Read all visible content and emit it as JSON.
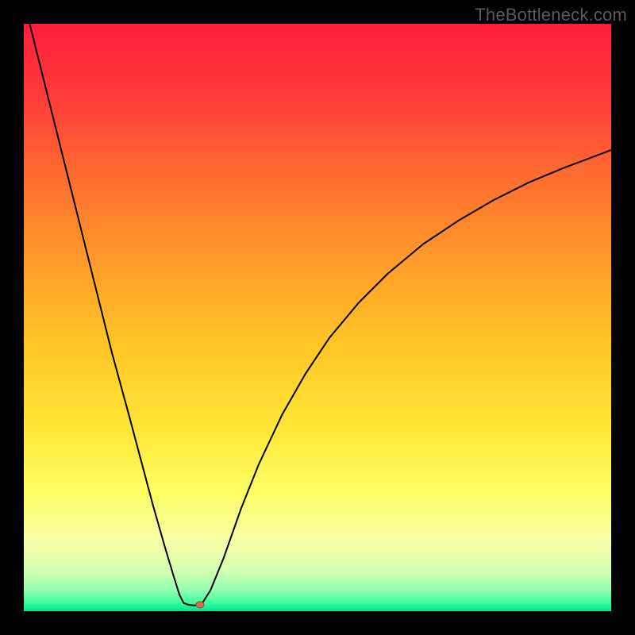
{
  "watermark": "TheBottleneck.com",
  "chart_data": {
    "type": "line",
    "title": "",
    "xlabel": "",
    "ylabel": "",
    "xlim": [
      0,
      100
    ],
    "ylim": [
      0,
      100
    ],
    "grid": false,
    "legend": false,
    "background_gradient": {
      "direction": "vertical",
      "stops": [
        {
          "offset": 0.0,
          "color": "#ff1e3c"
        },
        {
          "offset": 0.12,
          "color": "#ff3a3a"
        },
        {
          "offset": 0.25,
          "color": "#ff6a30"
        },
        {
          "offset": 0.4,
          "color": "#ff9a2a"
        },
        {
          "offset": 0.55,
          "color": "#ffc626"
        },
        {
          "offset": 0.7,
          "color": "#ffe93a"
        },
        {
          "offset": 0.8,
          "color": "#feff66"
        },
        {
          "offset": 0.88,
          "color": "#f6ffa6"
        },
        {
          "offset": 0.93,
          "color": "#d6ffb0"
        },
        {
          "offset": 0.965,
          "color": "#8fffb0"
        },
        {
          "offset": 0.985,
          "color": "#3cffa0"
        },
        {
          "offset": 1.0,
          "color": "#00e58a"
        }
      ]
    },
    "curve": {
      "color": "#000000",
      "width": 2,
      "points": [
        {
          "x": 1.0,
          "y": 100.0
        },
        {
          "x": 3.0,
          "y": 92.0
        },
        {
          "x": 6.0,
          "y": 80.0
        },
        {
          "x": 9.0,
          "y": 68.0
        },
        {
          "x": 12.0,
          "y": 56.0
        },
        {
          "x": 15.0,
          "y": 44.0
        },
        {
          "x": 18.0,
          "y": 33.0
        },
        {
          "x": 20.0,
          "y": 25.5
        },
        {
          "x": 22.0,
          "y": 18.0
        },
        {
          "x": 24.0,
          "y": 11.0
        },
        {
          "x": 25.5,
          "y": 6.0
        },
        {
          "x": 26.5,
          "y": 2.8
        },
        {
          "x": 27.2,
          "y": 1.4
        },
        {
          "x": 28.0,
          "y": 1.1
        },
        {
          "x": 28.8,
          "y": 1.0
        },
        {
          "x": 29.6,
          "y": 1.0
        },
        {
          "x": 30.4,
          "y": 1.4
        },
        {
          "x": 31.8,
          "y": 3.6
        },
        {
          "x": 34.0,
          "y": 9.0
        },
        {
          "x": 37.0,
          "y": 17.5
        },
        {
          "x": 40.0,
          "y": 25.0
        },
        {
          "x": 44.0,
          "y": 33.5
        },
        {
          "x": 48.0,
          "y": 40.5
        },
        {
          "x": 52.0,
          "y": 46.5
        },
        {
          "x": 57.0,
          "y": 52.5
        },
        {
          "x": 62.0,
          "y": 57.5
        },
        {
          "x": 68.0,
          "y": 62.5
        },
        {
          "x": 74.0,
          "y": 66.5
        },
        {
          "x": 80.0,
          "y": 70.0
        },
        {
          "x": 86.0,
          "y": 73.0
        },
        {
          "x": 92.0,
          "y": 75.5
        },
        {
          "x": 100.0,
          "y": 78.5
        }
      ]
    },
    "optimal_marker": {
      "x": 30.0,
      "y": 1.1,
      "rx": 5,
      "ry": 4,
      "fill": "#d66a5a",
      "stroke": "#9a4a3e"
    }
  }
}
